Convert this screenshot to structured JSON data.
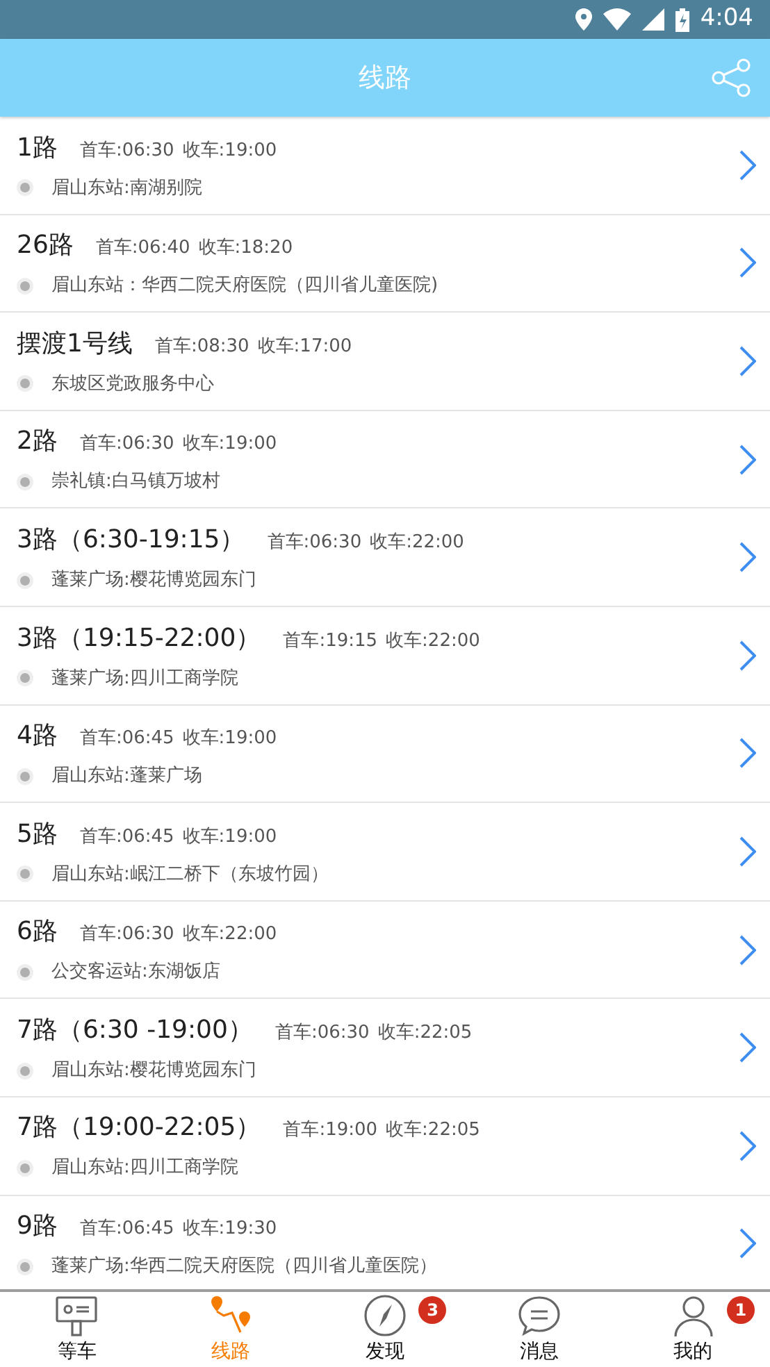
{
  "status_bar": {
    "time": "4:04"
  },
  "header": {
    "title": "线路"
  },
  "routes": [
    {
      "name": "1路",
      "first": "首车:06:30",
      "last": "收车:19:00",
      "stop": "眉山东站:南湖别院"
    },
    {
      "name": "26路",
      "first": "首车:06:40",
      "last": "收车:18:20",
      "stop": "眉山东站：华西二院天府医院（四川省儿童医院)"
    },
    {
      "name": "摆渡1号线",
      "first": "首车:08:30",
      "last": "收车:17:00",
      "stop": "东坡区党政服务中心"
    },
    {
      "name": "2路",
      "first": "首车:06:30",
      "last": "收车:19:00",
      "stop": "崇礼镇:白马镇万坡村"
    },
    {
      "name": "3路（6:30-19:15）",
      "first": "首车:06:30",
      "last": "收车:22:00",
      "stop": "蓬莱广场:樱花博览园东门"
    },
    {
      "name": "3路（19:15-22:00）",
      "first": "首车:19:15",
      "last": "收车:22:00",
      "stop": "蓬莱广场:四川工商学院"
    },
    {
      "name": "4路",
      "first": "首车:06:45",
      "last": "收车:19:00",
      "stop": "眉山东站:蓬莱广场"
    },
    {
      "name": "5路",
      "first": "首车:06:45",
      "last": "收车:19:00",
      "stop": "眉山东站:岷江二桥下（东坡竹园）"
    },
    {
      "name": "6路",
      "first": "首车:06:30",
      "last": "收车:22:00",
      "stop": "公交客运站:东湖饭店"
    },
    {
      "name": "7路（6:30 -19:00）",
      "first": "首车:06:30",
      "last": "收车:22:05",
      "stop": "眉山东站:樱花博览园东门"
    },
    {
      "name": "7路（19:00-22:05）",
      "first": "首车:19:00",
      "last": "收车:22:05",
      "stop": "眉山东站:四川工商学院"
    },
    {
      "name": "9路",
      "first": "首车:06:45",
      "last": "收车:19:30",
      "stop": "蓬莱广场:华西二院天府医院（四川省儿童医院）"
    }
  ],
  "tab_bar": [
    {
      "kind": "wait",
      "label": "等车",
      "selected": false
    },
    {
      "kind": "route",
      "label": "线路",
      "selected": true
    },
    {
      "kind": "discover",
      "label": "发现",
      "selected": false,
      "badge": "3"
    },
    {
      "kind": "message",
      "label": "消息",
      "selected": false
    },
    {
      "kind": "me",
      "label": "我的",
      "selected": false,
      "badge": "1"
    }
  ]
}
